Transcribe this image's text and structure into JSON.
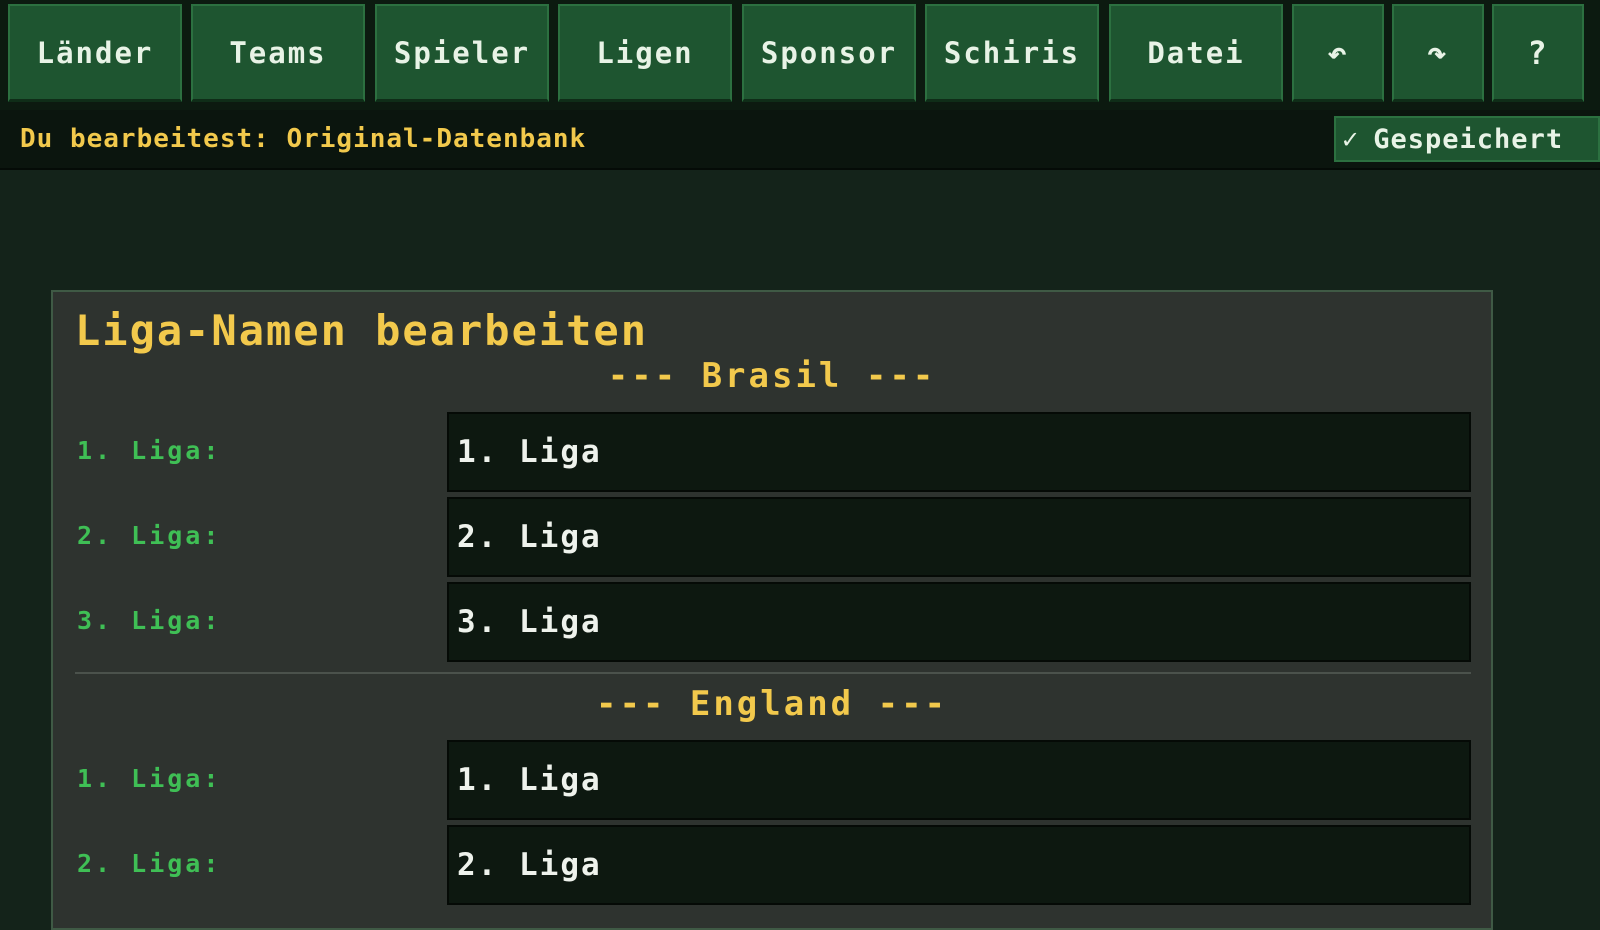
{
  "nav": {
    "items": [
      {
        "label": "Länder"
      },
      {
        "label": "Teams"
      },
      {
        "label": "Spieler"
      },
      {
        "label": "Ligen"
      },
      {
        "label": "Sponsor"
      },
      {
        "label": "Schiris"
      },
      {
        "label": "Datei"
      }
    ],
    "undo_glyph": "↶",
    "redo_glyph": "↷",
    "help_glyph": "?"
  },
  "status": {
    "text": "Du bearbeitest: Original-Datenbank",
    "saved_check": "✓",
    "saved_label": "Gespeichert"
  },
  "panel": {
    "title": "Liga-Namen bearbeiten",
    "sections": [
      {
        "header": "--- Brasil ---",
        "rows": [
          {
            "label": "1. Liga:",
            "value": "1. Liga"
          },
          {
            "label": "2. Liga:",
            "value": "2. Liga"
          },
          {
            "label": "3. Liga:",
            "value": "3. Liga"
          }
        ]
      },
      {
        "header": "--- England ---",
        "rows": [
          {
            "label": "1. Liga:",
            "value": "1. Liga"
          },
          {
            "label": "2. Liga:",
            "value": "2. Liga"
          }
        ]
      }
    ]
  },
  "colors": {
    "background": "#14231a",
    "button": "#1e5530",
    "accent_yellow": "#f2c94c",
    "label_green": "#3fbf55",
    "input_bg": "#0d1810"
  },
  "icons": {
    "undo": "undo-icon",
    "redo": "redo-icon",
    "help": "help-icon",
    "saved": "checkmark-icon"
  }
}
